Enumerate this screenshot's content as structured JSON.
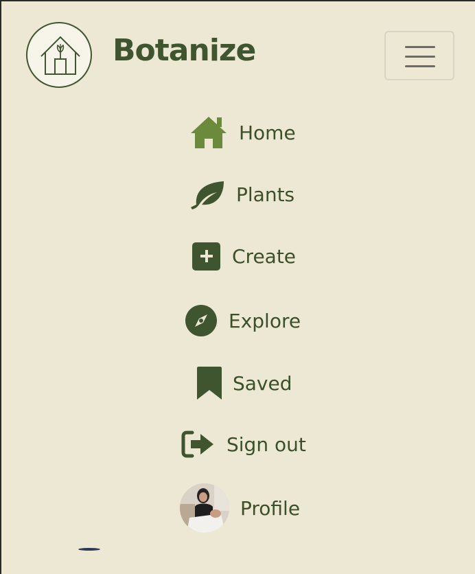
{
  "header": {
    "brand": "Botanize",
    "menu_icon": "hamburger-icon",
    "logo_icon": "house-plant-logo"
  },
  "nav": {
    "items": [
      {
        "label": "Home",
        "icon": "home-icon"
      },
      {
        "label": "Plants",
        "icon": "leaf-icon"
      },
      {
        "label": "Create",
        "icon": "plus-square-icon"
      },
      {
        "label": "Explore",
        "icon": "compass-icon"
      },
      {
        "label": "Saved",
        "icon": "bookmark-icon"
      },
      {
        "label": "Sign out",
        "icon": "sign-out-icon"
      },
      {
        "label": "Profile",
        "icon": "avatar"
      }
    ]
  },
  "colors": {
    "background": "#ede8d3",
    "primary_text": "#3a4f2a",
    "icon_green": "#3e5530",
    "home_icon_green": "#6b8a3c"
  }
}
